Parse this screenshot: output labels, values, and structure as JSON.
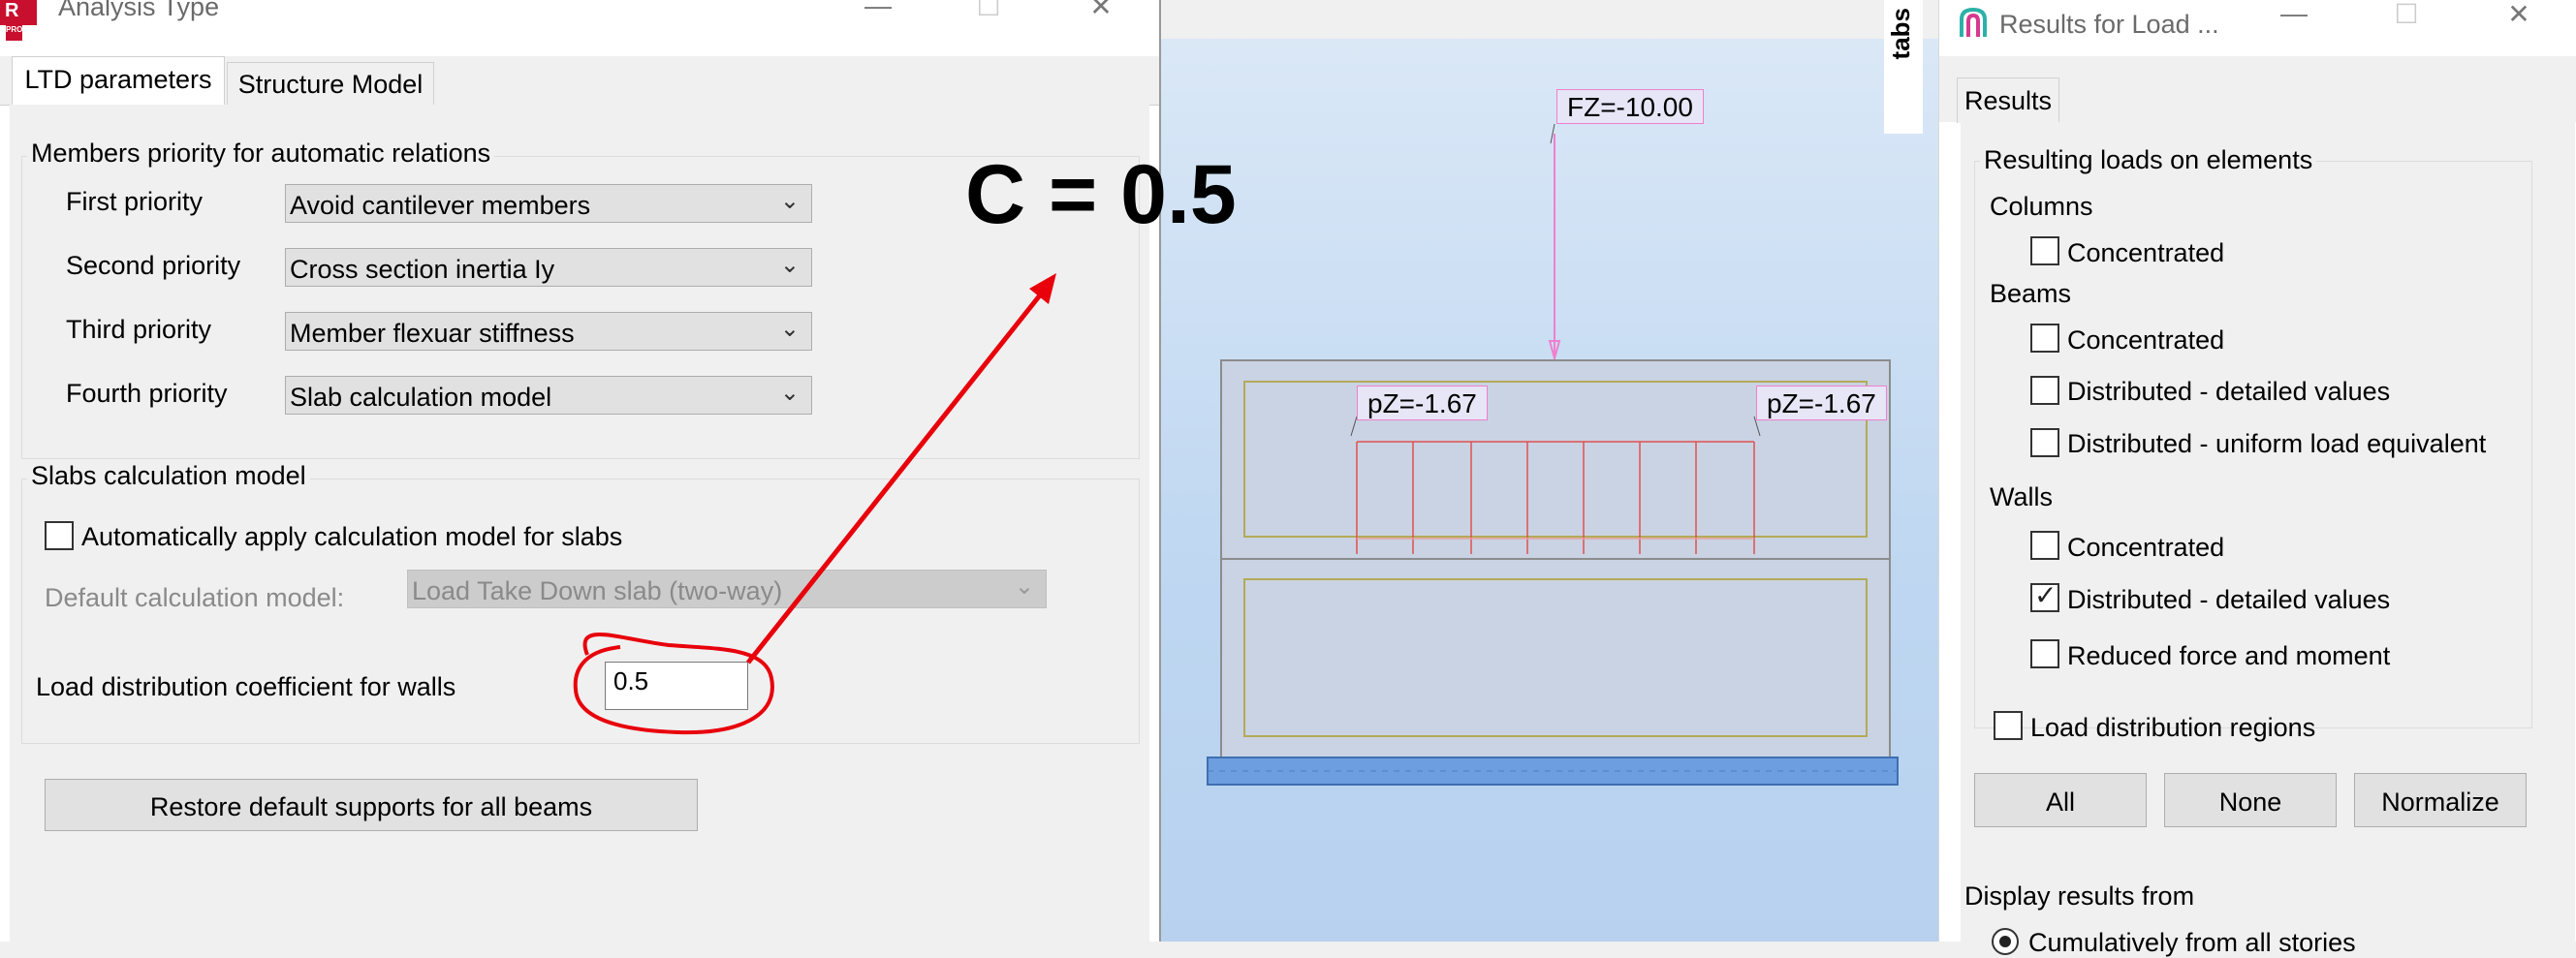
{
  "left_dialog": {
    "title": "Analysis Type",
    "app_badge": "R",
    "app_badge_sub": "PRO",
    "window_controls": {
      "minimize": "—",
      "maximize": "☐",
      "close": "✕"
    },
    "tabs": [
      {
        "label": "LTD parameters",
        "active": true
      },
      {
        "label": "Structure Model",
        "active": false
      }
    ],
    "members_group": {
      "title": "Members priority for automatic relations",
      "rows": [
        {
          "label": "First priority",
          "value": "Avoid cantilever members"
        },
        {
          "label": "Second priority",
          "value": "Cross section inertia Iy"
        },
        {
          "label": "Third priority",
          "value": "Member flexuar stiffness"
        },
        {
          "label": "Fourth priority",
          "value": "Slab calculation model"
        }
      ]
    },
    "slabs_group": {
      "title": "Slabs calculation model",
      "auto_apply_label": "Automatically apply calculation model for slabs",
      "auto_apply_checked": false,
      "default_model_label": "Default calculation model:",
      "default_model_value": "Load Take Down slab (two-way)"
    },
    "coefficient": {
      "label": "Load distribution coefficient for walls",
      "value": "0.5"
    },
    "restore_button": "Restore default supports for all beams"
  },
  "annotation": {
    "text": "C = 0.5",
    "color": "#e8000b"
  },
  "viewport": {
    "side_tab": "tabs",
    "point_load": "FZ=-10.00",
    "dist_load_left": "pZ=-1.67",
    "dist_load_right": "pZ=-1.67"
  },
  "right_panel": {
    "title": "Results for Load ...",
    "window_controls": {
      "minimize": "—",
      "maximize": "☐",
      "close": "✕"
    },
    "tab": "Results",
    "resulting_group_title": "Resulting loads on elements",
    "columns": {
      "heading": "Columns",
      "concentrated": "Concentrated",
      "concentrated_checked": false
    },
    "beams": {
      "heading": "Beams",
      "concentrated": "Concentrated",
      "distributed_detailed": "Distributed - detailed values",
      "distributed_uniform": "Distributed - uniform load equivalent"
    },
    "walls": {
      "heading": "Walls",
      "concentrated": "Concentrated",
      "distributed_detailed": "Distributed - detailed values",
      "distributed_detailed_checked": true,
      "reduced": "Reduced force and moment"
    },
    "load_regions": "Load distribution regions",
    "buttons": {
      "all": "All",
      "none": "None",
      "normalize": "Normalize"
    },
    "display_from": "Display results from",
    "display_option_partial": "Cumulatively from all stories"
  },
  "colors": {
    "red_annotation": "#e8000b",
    "load_pink": "#ef7fcf",
    "member_red": "#e05050",
    "wall_fill": "#c9d3e3",
    "wall_inner_border": "#b4aa57",
    "support_blue": "#6d9fe0"
  }
}
